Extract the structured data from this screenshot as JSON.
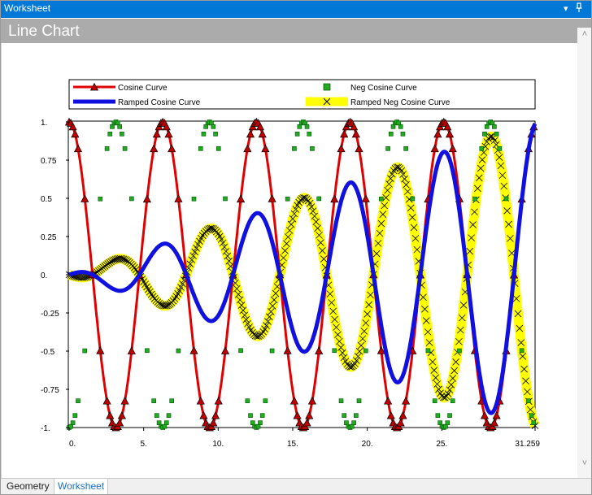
{
  "window": {
    "title": "Worksheet",
    "pin_glyph": "📌",
    "menu_glyph": "▾"
  },
  "header": {
    "title": "Line Chart"
  },
  "tabs": [
    {
      "label": "Geometry"
    },
    {
      "label": "Worksheet"
    }
  ],
  "colors": {
    "titlebar": "#0078d7",
    "header": "#ababab",
    "cosine": "#e00000",
    "ramped": "#1010e0",
    "neg": "#22aa22",
    "ramped_neg": "#ffff00"
  },
  "chart_data": {
    "type": "line",
    "xlim": [
      0,
      31.259
    ],
    "ylim": [
      -1,
      1
    ],
    "xticks": [
      "0.",
      "5.",
      "10.",
      "15.",
      "20.",
      "25.",
      "31.259"
    ],
    "yticks": [
      "1.",
      "0.75",
      "0.5",
      "0.25",
      "0.",
      "-0.25",
      "-0.5",
      "-0.75",
      "-1."
    ],
    "xtick_values": [
      0,
      5,
      10,
      15,
      20,
      25,
      31.259
    ],
    "ytick_values": [
      1,
      0.75,
      0.5,
      0.25,
      0,
      -0.25,
      -0.5,
      -0.75,
      -1
    ],
    "legend_placement": "top",
    "series": [
      {
        "name": "Cosine Curve",
        "function": "cos(x)",
        "marker": "triangle",
        "color": "#e00000"
      },
      {
        "name": "Neg Cosine Curve",
        "function": "-cos(x)",
        "marker": "square",
        "color": "#22aa22"
      },
      {
        "name": "Ramped Cosine Curve",
        "function": "(x/31.259)*cos(x)",
        "marker": "none",
        "color": "#1010e0"
      },
      {
        "name": "Ramped Neg Cosine Curve",
        "function": "-(x/31.259)*cos(x)",
        "marker": "x",
        "color": "#ffff00"
      }
    ]
  }
}
